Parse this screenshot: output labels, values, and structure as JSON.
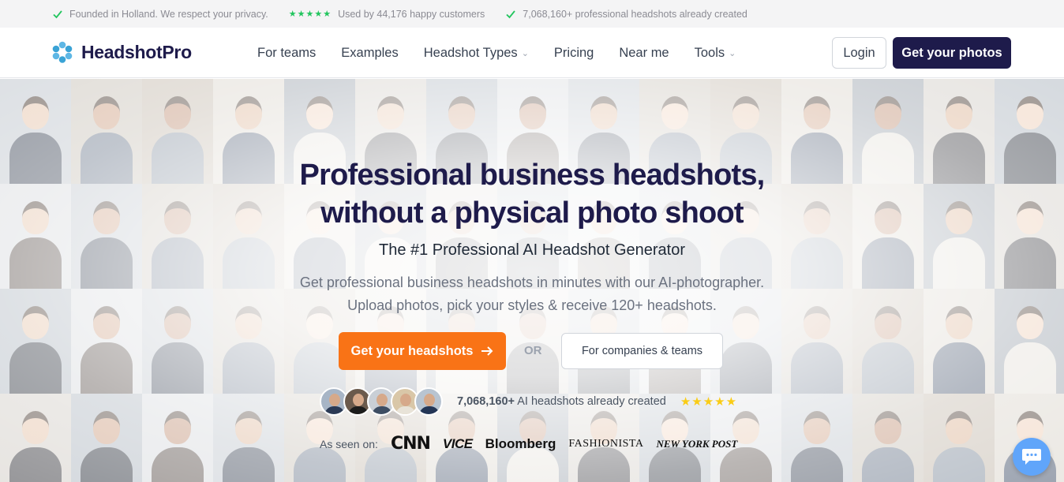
{
  "topbar": {
    "items": [
      {
        "text": "Founded in Holland. We respect your privacy.",
        "icon": "check-icon"
      },
      {
        "text": "Used by 44,176 happy customers",
        "icon": "five-stars",
        "stars": "★★★★★"
      },
      {
        "text": "7,068,160+ professional headshots already created",
        "icon": "check-icon"
      }
    ],
    "accent": "#22c55e"
  },
  "nav": {
    "brand": "HeadshotPro",
    "menu": [
      {
        "label": "For teams",
        "dropdown": false
      },
      {
        "label": "Examples",
        "dropdown": false
      },
      {
        "label": "Headshot Types",
        "dropdown": true
      },
      {
        "label": "Pricing",
        "dropdown": false
      },
      {
        "label": "Near me",
        "dropdown": false
      },
      {
        "label": "Tools",
        "dropdown": true
      }
    ],
    "login_label": "Login",
    "cta_label": "Get your photos"
  },
  "hero": {
    "headline_line1": "Professional business headshots,",
    "headline_line2": "without a physical photo shoot",
    "subhead": "The #1 Professional AI Headshot Generator",
    "description": "Get professional business headshots in minutes with our AI-photographer. Upload photos, pick your styles & receive 120+ headshots.",
    "cta_label": "Get your headshots",
    "or_label": "OR",
    "teams_label": "For companies & teams",
    "proof_count": "7,068,160+",
    "proof_text": "AI headshots already created",
    "proof_stars": "★★★★★",
    "seen_label": "As seen on:",
    "press": [
      "CNN",
      "VICE",
      "Bloomberg",
      "FASHIONISTA",
      "NEW YORK POST"
    ]
  },
  "colors": {
    "brand_navy": "#1e1b4b",
    "cta_orange": "#f97316",
    "star_gold": "#facc15",
    "chat_blue": "#60a5fa"
  }
}
